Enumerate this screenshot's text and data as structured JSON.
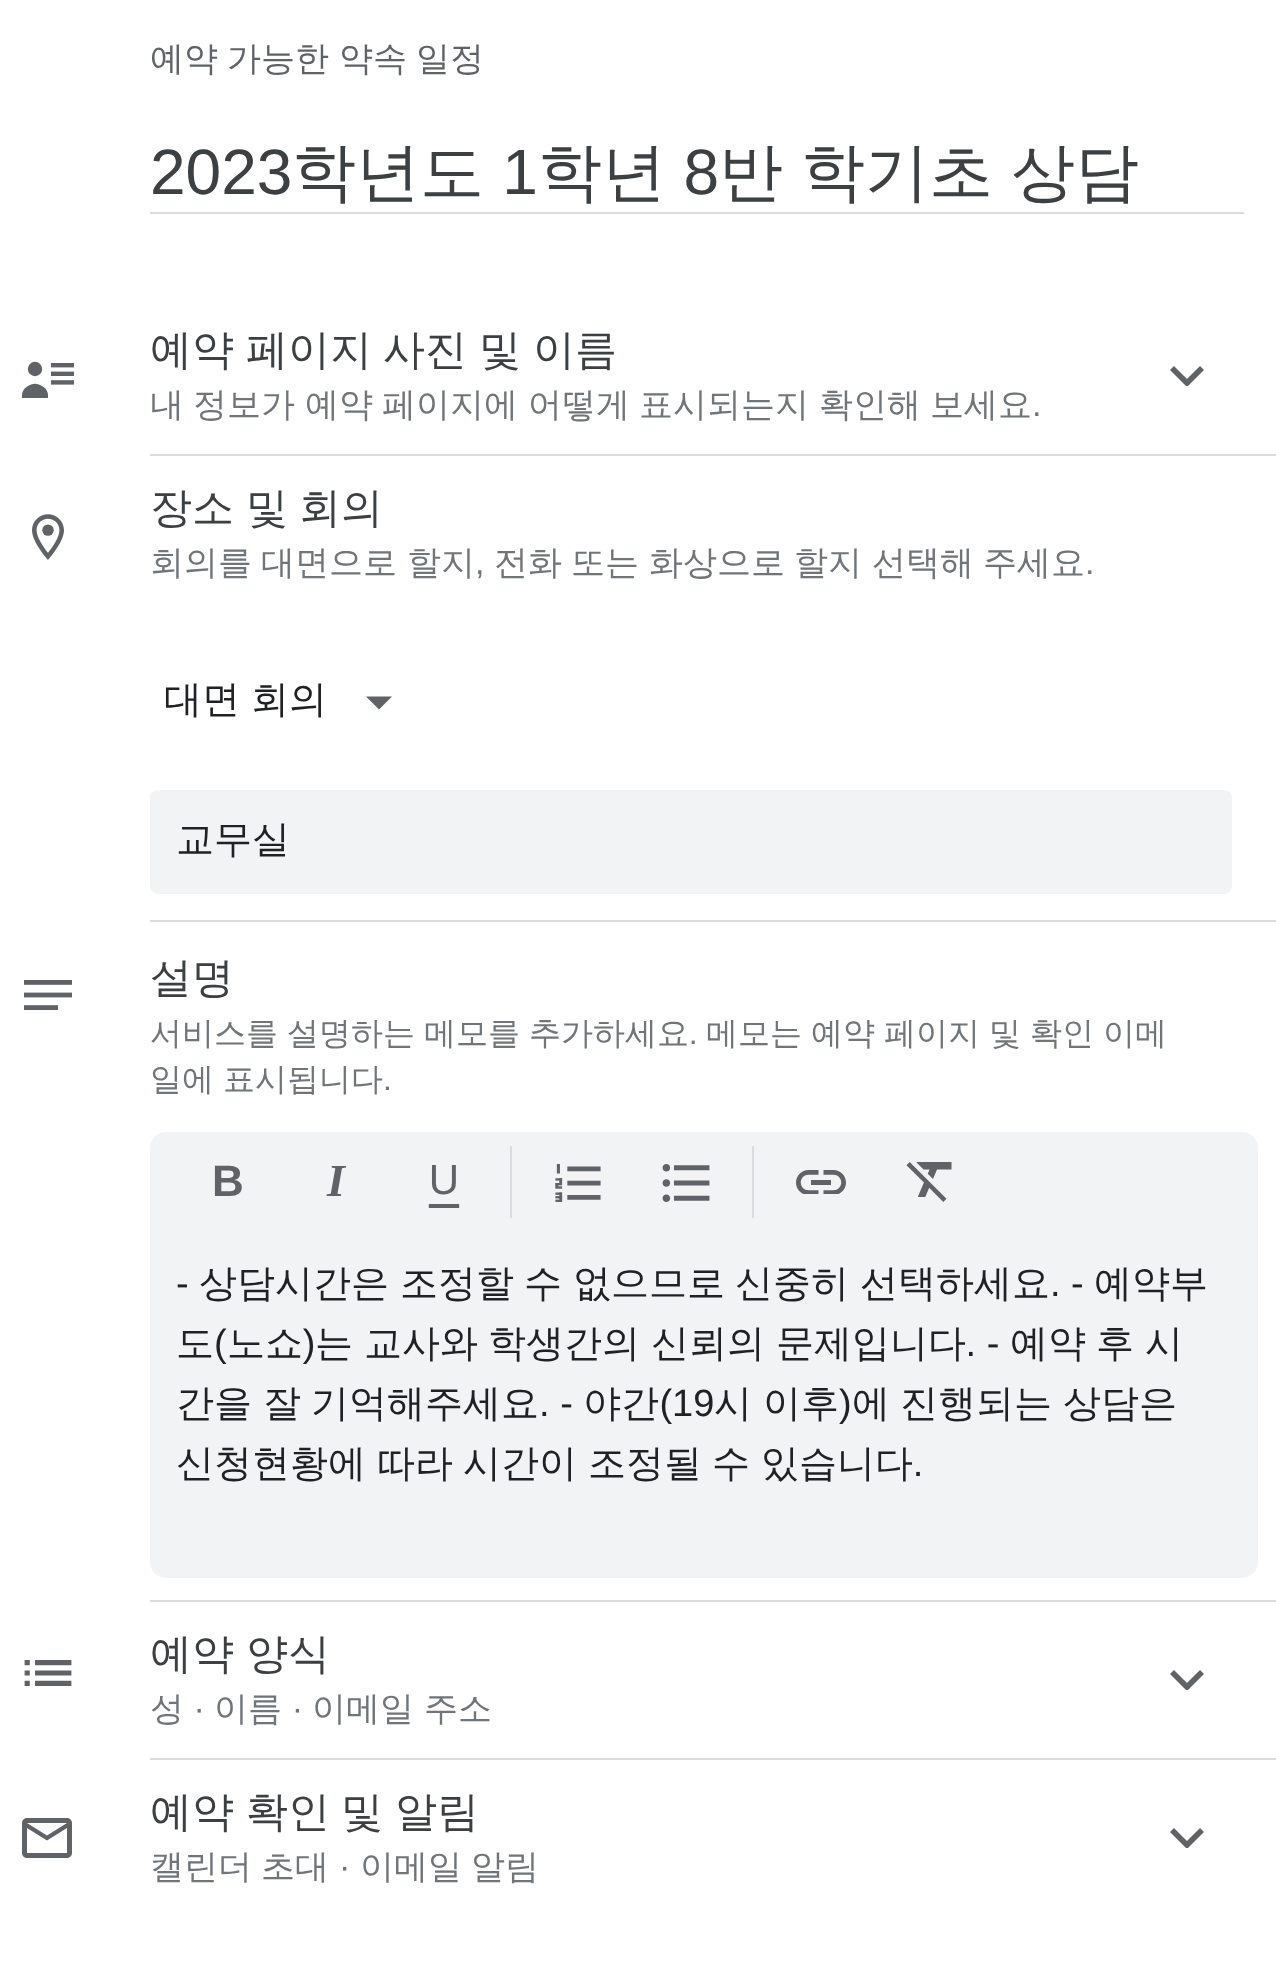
{
  "header": {
    "label": "예약 가능한 약속 일정",
    "title": "2023학년도 1학년 8반 학기초 상담"
  },
  "sections": [
    {
      "kind": "collapsible",
      "title": "예약 페이지 사진 및 이름",
      "description": "내 정보가 예약 페이지에 어떻게 표시되는지 확인해 보세요.",
      "expanded": false
    },
    {
      "kind": "location",
      "title": "장소 및 회의",
      "description": "회의를 대면으로 할지, 전화 또는 화상으로 할지 선택해 주세요.",
      "meeting_type": "대면 회의",
      "location": {
        "value": "교무실"
      }
    },
    {
      "kind": "notes",
      "title": "설명",
      "description": "서비스를 설명하는 메모를 추가하세요. 메모는 예약 페이지 및 확인 이메일에 표시됩니다.",
      "toolbar": [
        [
          {
            "kind": "bold",
            "glyph": "B"
          },
          {
            "kind": "italic",
            "glyph": "I"
          },
          {
            "kind": "underline",
            "glyph": "U"
          }
        ],
        [
          {
            "kind": "numbered-list"
          },
          {
            "kind": "bulleted-list"
          }
        ],
        [
          {
            "kind": "link"
          },
          {
            "kind": "clear-format"
          }
        ]
      ],
      "value": "- 상담시간은 조정할 수 없으므로 신중히 선택하세요. - 예약부도(노쇼)는 교사와 학생간의 신뢰의 문제입니다. - 예약 후 시간을 잘 기억해주세요. - 야간(19시 이후)에 진행되는 상담은 신청현황에 따라 시간이 조정될 수 있습니다."
    },
    {
      "kind": "collapsible",
      "title": "예약 양식",
      "description": "성 · 이름 · 이메일 주소",
      "expanded": false
    },
    {
      "kind": "collapsible",
      "title": "예약 확인 및 알림",
      "description": "캘린더 초대 · 이메일 알림",
      "expanded": false
    }
  ]
}
